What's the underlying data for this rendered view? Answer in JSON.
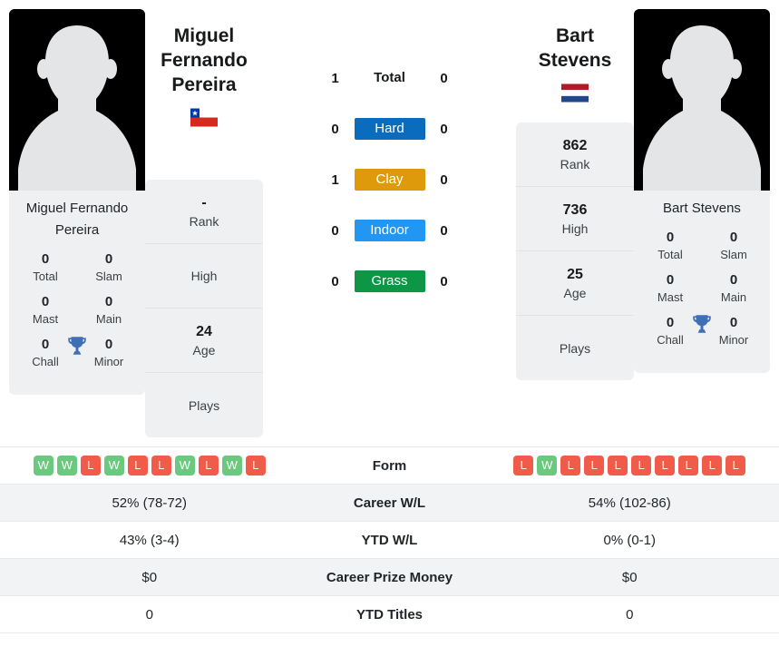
{
  "players": {
    "left": {
      "name": "Miguel Fernando Pereira",
      "photo_caption": "Miguel Fernando Pereira",
      "country": "Chile",
      "flag_icon": "chile-flag-icon",
      "rank": "-",
      "rank_label": "Rank",
      "high": "",
      "high_label": "High",
      "age": "24",
      "age_label": "Age",
      "plays": "",
      "plays_label": "Plays",
      "titles": {
        "total": "0",
        "total_label": "Total",
        "slam": "0",
        "slam_label": "Slam",
        "mast": "0",
        "mast_label": "Mast",
        "main": "0",
        "main_label": "Main",
        "chall": "0",
        "chall_label": "Chall",
        "minor": "0",
        "minor_label": "Minor"
      },
      "form": [
        "W",
        "W",
        "L",
        "W",
        "L",
        "L",
        "W",
        "L",
        "W",
        "L"
      ],
      "career_wl": "52% (78-72)",
      "ytd_wl": "43% (3-4)",
      "career_prize_money": "$0",
      "ytd_titles": "0"
    },
    "right": {
      "name": "Bart Stevens",
      "photo_caption": "Bart Stevens",
      "country": "Netherlands",
      "flag_icon": "netherlands-flag-icon",
      "rank": "862",
      "rank_label": "Rank",
      "high": "736",
      "high_label": "High",
      "age": "25",
      "age_label": "Age",
      "plays": "",
      "plays_label": "Plays",
      "titles": {
        "total": "0",
        "total_label": "Total",
        "slam": "0",
        "slam_label": "Slam",
        "mast": "0",
        "mast_label": "Mast",
        "main": "0",
        "main_label": "Main",
        "chall": "0",
        "chall_label": "Chall",
        "minor": "0",
        "minor_label": "Minor"
      },
      "form": [
        "L",
        "W",
        "L",
        "L",
        "L",
        "L",
        "L",
        "L",
        "L",
        "L"
      ],
      "career_wl": "54% (102-86)",
      "ytd_wl": "0% (0-1)",
      "career_prize_money": "$0",
      "ytd_titles": "0"
    }
  },
  "head_to_head": [
    {
      "label": "Total",
      "left": "1",
      "right": "0",
      "color": ""
    },
    {
      "label": "Hard",
      "left": "0",
      "right": "0",
      "color": "#0b6cbd"
    },
    {
      "label": "Clay",
      "left": "1",
      "right": "0",
      "color": "#de9a0a"
    },
    {
      "label": "Indoor",
      "left": "0",
      "right": "0",
      "color": "#2196f3"
    },
    {
      "label": "Grass",
      "left": "0",
      "right": "0",
      "color": "#0c9645"
    }
  ],
  "table_rows": [
    {
      "label": "Form",
      "key": "form"
    },
    {
      "label": "Career W/L",
      "key": "career_wl"
    },
    {
      "label": "YTD W/L",
      "key": "ytd_wl"
    },
    {
      "label": "Career Prize Money",
      "key": "career_prize_money"
    },
    {
      "label": "YTD Titles",
      "key": "ytd_titles"
    }
  ],
  "colors": {
    "win_badge": "#6ac97e",
    "loss_badge": "#f15c4a",
    "panel_bg": "#eff0f1",
    "row_shade": "#f2f3f4"
  }
}
